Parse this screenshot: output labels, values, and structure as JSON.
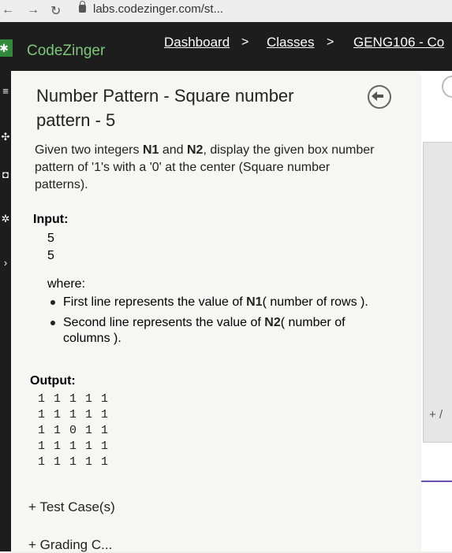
{
  "browser": {
    "url": "labs.codezinger.com/st...",
    "back_icon": "arrow-left-icon",
    "forward_icon": "arrow-right-icon",
    "reload_icon": "reload-icon"
  },
  "topnav": {
    "brand": "CodeZinger",
    "crumbs": [
      "Dashboard",
      "Classes",
      "GENG106 - Co"
    ],
    "separator": ">"
  },
  "problem": {
    "title": "Number Pattern - Square number pattern - 5",
    "desc_prefix": "Given two integers ",
    "n1": "N1",
    "and": " and ",
    "n2": "N2",
    "desc_suffix": ", display the given box number pattern of '1's with a '0' at the center (Square number patterns).",
    "input_label": "Input:",
    "input_values": [
      "5",
      "5"
    ],
    "where_label": "where:",
    "bullets": [
      {
        "prefix": "First line represents the value of ",
        "bold": "N1",
        "suffix": "( number of rows )."
      },
      {
        "prefix": "Second line represents the value of ",
        "bold": "N2",
        "suffix": "( number of columns )."
      }
    ],
    "output_label": "Output:",
    "output_rows": [
      "1 1 1 1 1",
      "1 1 1 1 1",
      "1 1 0 1 1",
      "1 1 1 1 1",
      "1 1 1 1 1"
    ],
    "test_cases_link": "+ Test Case(s)",
    "grading_link": "+ Grading C..."
  },
  "rightpane": {
    "plus_label": "+ /"
  },
  "colors": {
    "nav_bg": "#1d1d1d",
    "brand_green": "#7ec77a",
    "logo_green": "#2f8b3a",
    "accent_purple": "#6a4fb3"
  }
}
